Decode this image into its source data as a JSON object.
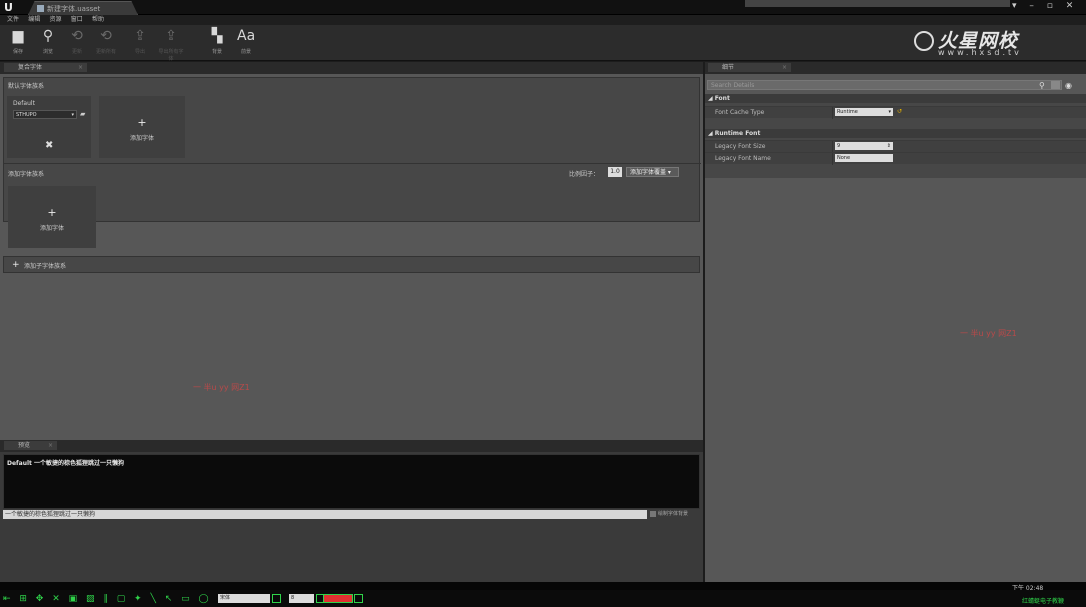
{
  "window": {
    "tab_title": "新建字体.uasset",
    "controls": "▾ – ▫ ✕"
  },
  "menu": [
    "文件",
    "编辑",
    "资源",
    "窗口",
    "帮助"
  ],
  "toolbar": [
    {
      "icon": "save-icon",
      "glyph": "▆",
      "label": "保存",
      "enabled": true
    },
    {
      "icon": "browse-icon",
      "glyph": "⚲",
      "label": "浏览",
      "enabled": true
    },
    {
      "icon": "update-icon",
      "glyph": "⟲",
      "label": "更新",
      "enabled": false
    },
    {
      "icon": "update-all-icon",
      "glyph": "⟲",
      "label": "更新所有",
      "enabled": false
    },
    {
      "icon": "export-icon",
      "glyph": "⇪",
      "label": "导出",
      "enabled": false
    },
    {
      "icon": "export-all-icon",
      "glyph": "⇪",
      "label": "导出所有字体",
      "enabled": false
    },
    {
      "icon": "background-icon",
      "glyph": "▚",
      "label": "背景",
      "enabled": true
    },
    {
      "icon": "foreground-icon",
      "glyph": "Aa",
      "label": "前景",
      "enabled": true
    }
  ],
  "watermark": {
    "title": "火星网校",
    "url": "www.hxsd.tv"
  },
  "left_tab": "复合字体",
  "sections": {
    "default_family": "默认字体族系",
    "default_label": "Default",
    "font_value": "STHUPO",
    "add_font": "添加字体",
    "sub_family": "添加字体族系",
    "scale_label": "比例因子：",
    "scale_value": "1.0",
    "add_override": "添加字体覆盖 ▾",
    "add_sub_family": "添加子字体族系"
  },
  "annotations": {
    "left": "一 半u  yy 网Z1",
    "right": "一 半u  yy 网Z1"
  },
  "preview": {
    "tab": "预览",
    "text": "Default  一个敏捷的棕色狐狸跳过一只懒狗",
    "input": "一个敏捷的棕色狐狸跳过一只懒狗",
    "draw_bg": "绘制字体背景"
  },
  "details": {
    "tab": "细节",
    "search_placeholder": "Search Details",
    "cat_font": "◢ Font",
    "font_cache_type_label": "Font Cache Type",
    "font_cache_type_value": "Runtime",
    "cat_runtime": "◢ Runtime Font",
    "legacy_size_label": "Legacy Font Size",
    "legacy_size_value": "9",
    "legacy_name_label": "Legacy Font Name",
    "legacy_name_value": "None"
  },
  "taskbar": {
    "tools": "⇤ ⊞ ✥ ✕ ▣ ▨ ∥ ▢ ✦ ╲ ↖ ▭ ◯ ■ ● A",
    "font": "宋体",
    "size": "8",
    "clock": "下午 02:48",
    "tray": "红蜻蜓电子教鞭"
  }
}
